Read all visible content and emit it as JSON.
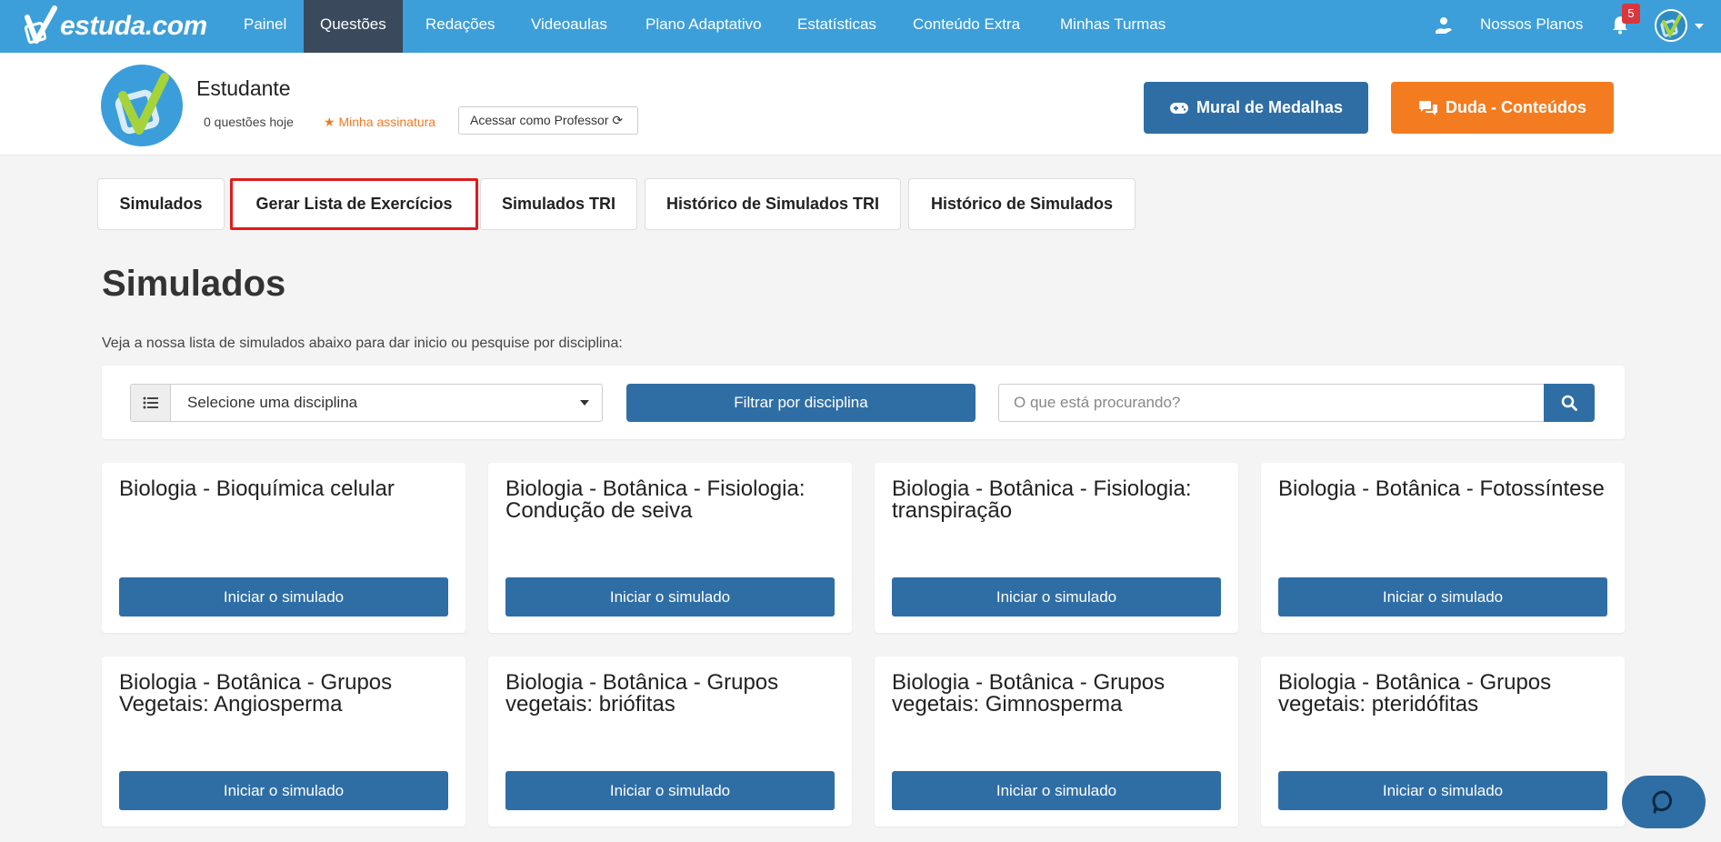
{
  "brand": {
    "logo_text": "estuda.com"
  },
  "nav": {
    "items": [
      {
        "label": "Painel"
      },
      {
        "label": "Questões"
      },
      {
        "label": "Redações"
      },
      {
        "label": "Videoaulas"
      },
      {
        "label": "Plano Adaptativo"
      },
      {
        "label": "Estatísticas"
      },
      {
        "label": "Conteúdo Extra"
      },
      {
        "label": "Minhas Turmas"
      }
    ],
    "active": "Questões",
    "plans_label": "Nossos Planos",
    "notification_count": "5"
  },
  "profile": {
    "name": "Estudante",
    "questions_today": "0 questões hoje",
    "subscription": "Minha assinatura",
    "teacher_access": "Acessar como Professor",
    "medals_button": "Mural de Medalhas",
    "duda_button": "Duda - Conteúdos"
  },
  "tabs": [
    {
      "label": "Simulados"
    },
    {
      "label": "Gerar Lista de Exercícios"
    },
    {
      "label": "Simulados TRI"
    },
    {
      "label": "Histórico de Simulados TRI"
    },
    {
      "label": "Histórico de Simulados"
    }
  ],
  "page": {
    "title": "Simulados",
    "subtitle": "Veja a nossa lista de simulados abaixo para dar inicio ou pesquise por disciplina:"
  },
  "filter": {
    "select_value": "Selecione uma disciplina",
    "filter_button": "Filtrar por disciplina",
    "search_placeholder": "O que está procurando?"
  },
  "cards": [
    {
      "title": "Biologia - Bioquímica celular",
      "button": "Iniciar o simulado"
    },
    {
      "title": "Biologia - Botânica - Fisiologia: Condução de seiva",
      "button": "Iniciar o simulado"
    },
    {
      "title": "Biologia - Botânica - Fisiologia: transpiração",
      "button": "Iniciar o simulado"
    },
    {
      "title": "Biologia - Botânica - Fotossíntese",
      "button": "Iniciar o simulado"
    },
    {
      "title": "Biologia - Botânica - Grupos Vegetais: Angiosperma",
      "button": "Iniciar o simulado"
    },
    {
      "title": "Biologia - Botânica - Grupos vegetais: briófitas",
      "button": "Iniciar o simulado"
    },
    {
      "title": "Biologia - Botânica - Grupos vegetais: Gimnosperma",
      "button": "Iniciar o simulado"
    },
    {
      "title": "Biologia - Botânica - Grupos vegetais: pteridófitas",
      "button": "Iniciar o simulado"
    }
  ],
  "colors": {
    "nav_bg": "#3d9fd9",
    "nav_active": "#3a4a5c",
    "primary_button": "#2f6ea5",
    "orange_button": "#f47c20",
    "highlight_border": "#e01b1b"
  }
}
